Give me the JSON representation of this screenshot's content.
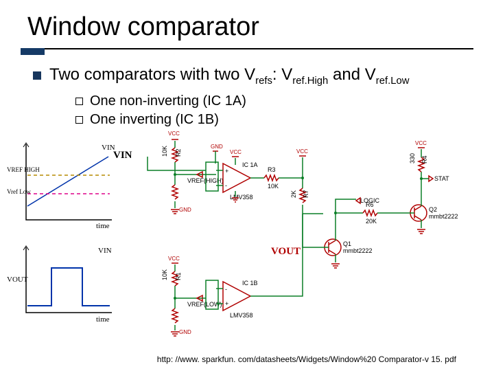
{
  "title": "Window comparator",
  "bullet": {
    "prefix": "Two comparators with two V",
    "sub1": "refs",
    "mid1": ": V",
    "sub2": "ref.High",
    "mid2": " and V",
    "sub3": "ref.Low"
  },
  "subs": {
    "a": "One non-inverting (IC 1A)",
    "b": "One inverting (IC 1B)"
  },
  "sketch": {
    "vin": "VIN",
    "vrefh": "VREF HIGH",
    "vrefl": "Vref Low",
    "time1": "time",
    "vout": "VOUT",
    "time2": "time",
    "vin2": "VIN"
  },
  "schem": {
    "vin": "VIN",
    "vout": "VOUT",
    "vcc": "VCC",
    "gnd": "GND",
    "vrefh": "VREF(HIGH)",
    "vrefl": "VREF(LOW)",
    "ic1a": "IC 1A",
    "ic1b": "IC 1B",
    "lmv": "LMV358",
    "r1": "R1",
    "r2": "R2",
    "r3": "R3",
    "r4": "R4",
    "r6": "R6",
    "r7": "R7",
    "r10k": "10K",
    "r2k": "2K",
    "r20k": "20K",
    "r330": "330",
    "q1": "Q1",
    "q2": "Q2",
    "mmbt": "mmbt2222",
    "logic": "LOGIC",
    "stat": "STAT"
  },
  "credit": "http: //www. sparkfun. com/datasheets/Widgets/Window%20 Comparator-v 15. pdf"
}
